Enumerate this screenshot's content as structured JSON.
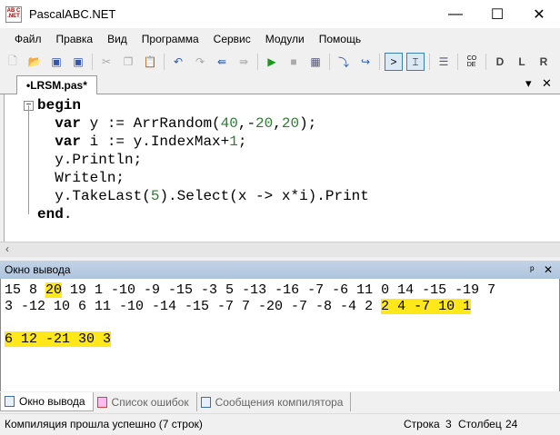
{
  "window": {
    "title": "PascalABC.NET",
    "icon_text": "AB C .NET"
  },
  "menu": [
    "Файл",
    "Правка",
    "Вид",
    "Программа",
    "Сервис",
    "Модули",
    "Помощь"
  ],
  "toolbar": [
    "new-file",
    "open",
    "save",
    "save-all",
    "cut",
    "copy",
    "paste",
    "undo",
    "redo",
    "format-left",
    "format-right",
    "run",
    "stop",
    "debug-window",
    "step-into",
    "step-over",
    "output-console",
    "output-text",
    "doc",
    "code",
    "debug-d",
    "debug-l",
    "debug-r"
  ],
  "doc_tab": {
    "label": "•LRSM.pas*"
  },
  "code": [
    [
      {
        "t": "begin",
        "c": "kw"
      }
    ],
    [
      {
        "t": "  "
      },
      {
        "t": "var",
        "c": "kw"
      },
      {
        "t": " y := ArrRandom("
      },
      {
        "t": "40",
        "c": "num"
      },
      {
        "t": ",-"
      },
      {
        "t": "20",
        "c": "num"
      },
      {
        "t": ","
      },
      {
        "t": "20",
        "c": "num"
      },
      {
        "t": ");"
      }
    ],
    [
      {
        "t": "  "
      },
      {
        "t": "var",
        "c": "kw"
      },
      {
        "t": " i := y.IndexMax+"
      },
      {
        "t": "1",
        "c": "num"
      },
      {
        "t": ";"
      }
    ],
    [
      {
        "t": "  y.Println;"
      }
    ],
    [
      {
        "t": "  Writeln;"
      }
    ],
    [
      {
        "t": "  y.TakeLast("
      },
      {
        "t": "5",
        "c": "num"
      },
      {
        "t": ").Select(x -> x*i).Print"
      }
    ],
    [
      {
        "t": "end",
        "c": "kw"
      },
      {
        "t": "."
      }
    ]
  ],
  "output_panel": {
    "title": "Окно вывода",
    "lines": [
      [
        {
          "t": "15 8 "
        },
        {
          "t": "20",
          "hl": true
        },
        {
          "t": " 19 1 -10 -9 -15 -3 5 -13 -16 -7 -6 11 0 14 -15 -19 7"
        }
      ],
      [
        {
          "t": "3 -12 10 6 11 -10 -14 -15 -7 7 -20 -7 -8 -4 2 "
        },
        {
          "t": "2 4 -7 10 1",
          "hl": true
        }
      ],
      [
        {
          "t": " "
        }
      ],
      [
        {
          "t": "6 12 -21 30 3",
          "hl": true
        }
      ]
    ]
  },
  "bottom_tabs": [
    "Окно вывода",
    "Список ошибок",
    "Сообщения компилятора"
  ],
  "status": {
    "message": "Компиляция прошла успешно (7 строк)",
    "line_label": "Строка",
    "line": "3",
    "col_label": "Столбец",
    "col": "24"
  },
  "colors": {
    "highlight": "#ffe81a",
    "number": "#2e7d32"
  }
}
